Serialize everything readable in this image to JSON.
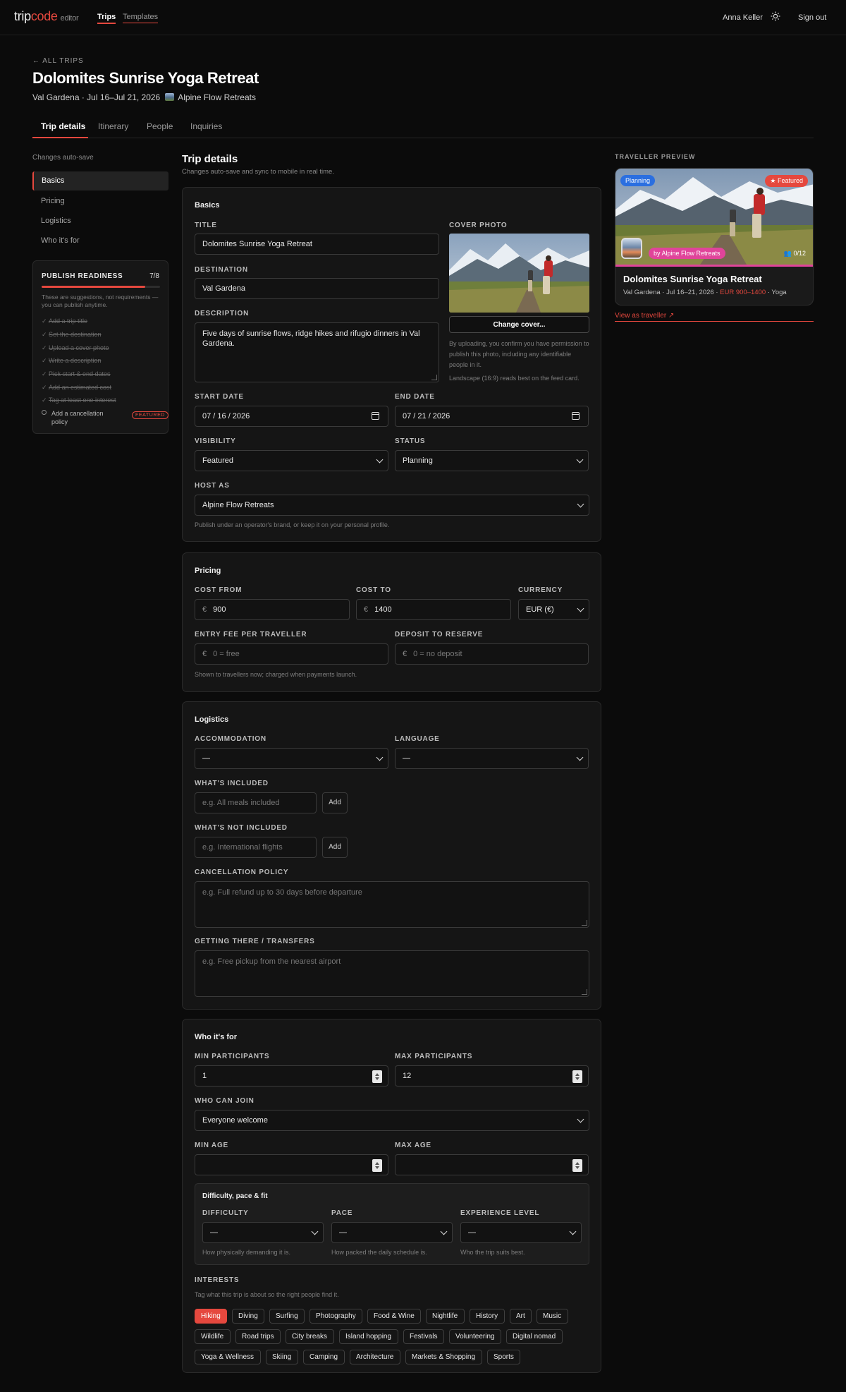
{
  "app": {
    "logo_a": "trip",
    "logo_b": "code",
    "logo_suffix": "editor"
  },
  "topnav": {
    "trips": "Trips",
    "templates": "Templates",
    "user": "Anna Keller",
    "sign_out": "Sign out"
  },
  "header": {
    "back": "← ALL TRIPS",
    "title": "Dolomites Sunrise Yoga Retreat",
    "subline": "Val Gardena · Jul 16–Jul 21, 2026",
    "host": "Alpine Flow Retreats"
  },
  "tabs": [
    "Trip details",
    "Itinerary",
    "People",
    "Inquiries"
  ],
  "sidebar": {
    "autosave": "Changes auto-save",
    "items": [
      "Basics",
      "Pricing",
      "Logistics",
      "Who it's for"
    ],
    "readiness": {
      "title": "PUBLISH READINESS",
      "count": "7/8",
      "progress": 0.875,
      "note": "These are suggestions, not requirements — you can publish anytime.",
      "done": [
        "Add a trip title",
        "Set the destination",
        "Upload a cover photo",
        "Write a description",
        "Pick start & end dates",
        "Add an estimated cost",
        "Tag at least one interest"
      ],
      "open": "Add a cancellation policy",
      "open_badge": "FEATURED"
    }
  },
  "main": {
    "title": "Trip details",
    "subtitle": "Changes auto-save and sync to mobile in real time."
  },
  "basics": {
    "heading": "Basics",
    "title_label": "TITLE",
    "title_value": "Dolomites Sunrise Yoga Retreat",
    "dest_label": "DESTINATION",
    "dest_value": "Val Gardena",
    "desc_label": "DESCRIPTION",
    "desc_value": "Five days of sunrise flows, ridge hikes and rifugio dinners in Val Gardena.",
    "cover_label": "COVER PHOTO",
    "change_cover": "Change cover...",
    "cover_note": "By uploading, you confirm you have permission to publish this photo, including any identifiable people in it.",
    "cover_hint": "Landscape (16:9) reads best on the feed card.",
    "start_label": "START DATE",
    "start_value": "07 / 16 / 2026",
    "end_label": "END DATE",
    "end_value": "07 / 21 / 2026",
    "visibility_label": "VISIBILITY",
    "visibility_value": "Featured",
    "status_label": "STATUS",
    "status_value": "Planning",
    "host_label": "HOST AS",
    "host_value": "Alpine Flow Retreats",
    "host_help": "Publish under an operator's brand, or keep it on your personal profile."
  },
  "pricing": {
    "heading": "Pricing",
    "cost_from_label": "COST FROM",
    "cost_from": "900",
    "cost_to_label": "COST TO",
    "cost_to": "1400",
    "currency_label": "CURRENCY",
    "currency": "EUR (€)",
    "symbol": "€",
    "entry_label": "ENTRY FEE PER TRAVELLER",
    "entry_ph": "0 = free",
    "deposit_label": "DEPOSIT TO RESERVE",
    "deposit_ph": "0 = no deposit",
    "help": "Shown to travellers now; charged when payments launch."
  },
  "logistics": {
    "heading": "Logistics",
    "accom_label": "ACCOMMODATION",
    "accom_value": "—",
    "lang_label": "LANGUAGE",
    "lang_value": "—",
    "incl_label": "WHAT'S INCLUDED",
    "incl_ph": "e.g. All meals included",
    "notincl_label": "WHAT'S NOT INCLUDED",
    "notincl_ph": "e.g. International flights",
    "add": "Add",
    "cancel_label": "CANCELLATION POLICY",
    "cancel_ph": "e.g. Full refund up to 30 days before departure",
    "transfer_label": "GETTING THERE / TRANSFERS",
    "transfer_ph": "e.g. Free pickup from the nearest airport"
  },
  "who": {
    "heading": "Who it's for",
    "min_label": "MIN PARTICIPANTS",
    "min_value": "1",
    "max_label": "MAX PARTICIPANTS",
    "max_value": "12",
    "join_label": "WHO CAN JOIN",
    "join_value": "Everyone welcome",
    "min_age_label": "MIN AGE",
    "max_age_label": "MAX AGE",
    "diff_heading": "Difficulty, pace & fit",
    "difficulty_label": "DIFFICULTY",
    "difficulty_value": "—",
    "difficulty_help": "How physically demanding it is.",
    "pace_label": "PACE",
    "pace_value": "—",
    "pace_help": "How packed the daily schedule is.",
    "exp_label": "EXPERIENCE LEVEL",
    "exp_value": "—",
    "exp_help": "Who the trip suits best.",
    "interests_label": "INTERESTS",
    "interests_help": "Tag what this trip is about so the right people find it.",
    "interests": [
      "Hiking",
      "Diving",
      "Surfing",
      "Photography",
      "Food & Wine",
      "Nightlife",
      "History",
      "Art",
      "Music",
      "Wildlife",
      "Road trips",
      "City breaks",
      "Island hopping",
      "Festivals",
      "Volunteering",
      "Digital nomad",
      "Yoga & Wellness",
      "Skiing",
      "Camping",
      "Architecture",
      "Markets & Shopping",
      "Sports"
    ],
    "selected_interest": "Hiking"
  },
  "preview": {
    "label": "TRAVELLER PREVIEW",
    "status_pill": "Planning",
    "featured_pill": "★ Featured",
    "host_pill": "by Alpine Flow Retreats",
    "count": "0/12",
    "title": "Dolomites Sunrise Yoga Retreat",
    "meta_a": "Val Gardena · Jul 16–21, 2026 · ",
    "meta_price": "EUR 900–1400",
    "meta_b": " · Yoga",
    "link": "View as traveller ↗"
  },
  "colors": {
    "accent": "#e5483e",
    "planning": "#2b6fe0",
    "host_pink": "#e0449a"
  }
}
